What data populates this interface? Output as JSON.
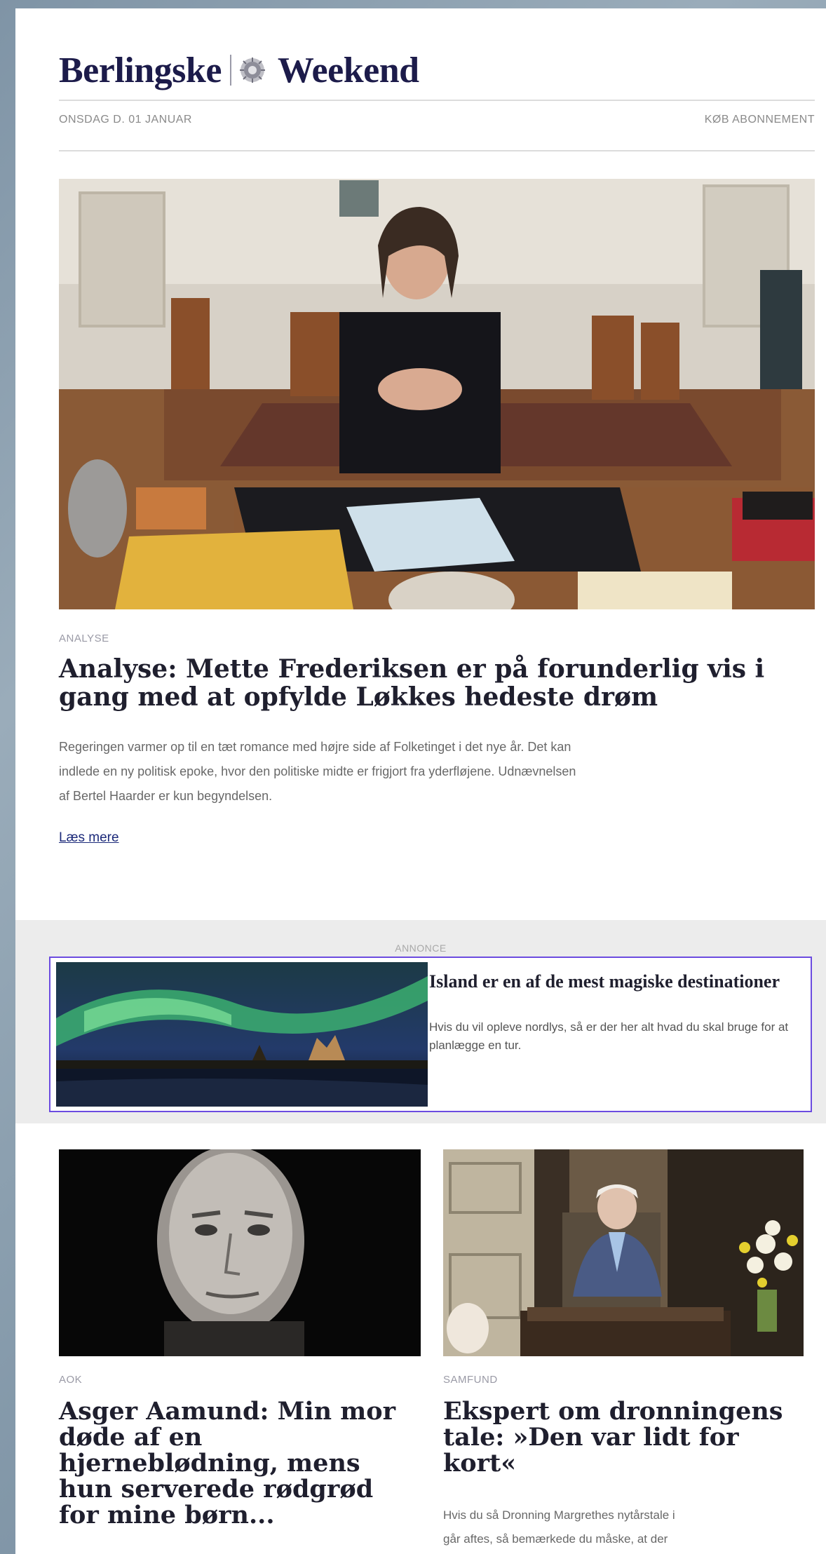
{
  "masthead": {
    "brand": "Berlingske",
    "section": "Weekend"
  },
  "topbar": {
    "date": "ONSDAG D. 01 JANUAR",
    "subscribe": "KØB ABONNEMENT"
  },
  "lead_article": {
    "kicker": "ANALYSE",
    "headline": "Analyse: Mette Frederiksen er på forunderlig vis i gang med at opfylde Løkkes hedeste drøm",
    "teaser_lines": [
      "Regeringen varmer op til en tæt romance med højre side af Folketinget i det nye år. Det kan",
      "indlede en ny politisk epoke, hvor den politiske midte er frigjort fra yderfløjene. Udnævnelsen",
      "af Bertel Haarder er kun begyndelsen."
    ],
    "read_more": "Læs mere"
  },
  "ad": {
    "label": "ANNONCE",
    "title": "Island er en af de mest magiske destinationer",
    "text": "Hvis du vil opleve nordlys, så er der her alt hvad du skal bruge for at planlægge en tur."
  },
  "articles": [
    {
      "kicker": "AOK",
      "headline_lines": [
        "Asger Aamund: Min mor",
        "døde af en",
        "hjerneblødning, mens",
        "hun serverede rødgrød",
        "for mine børn..."
      ]
    },
    {
      "kicker": "SAMFUND",
      "headline_lines": [
        "Ekspert om dronningens",
        "tale: »Den var lidt for",
        "kort«"
      ],
      "teaser_lines": [
        "Hvis du så Dronning Margrethes nytårstale i",
        "går aftes, så bemærkede du måske, at der"
      ]
    }
  ],
  "colors": {
    "brand_navy": "#1c1b4a",
    "ad_border": "#6b4be0",
    "link": "#1c2a7a"
  }
}
